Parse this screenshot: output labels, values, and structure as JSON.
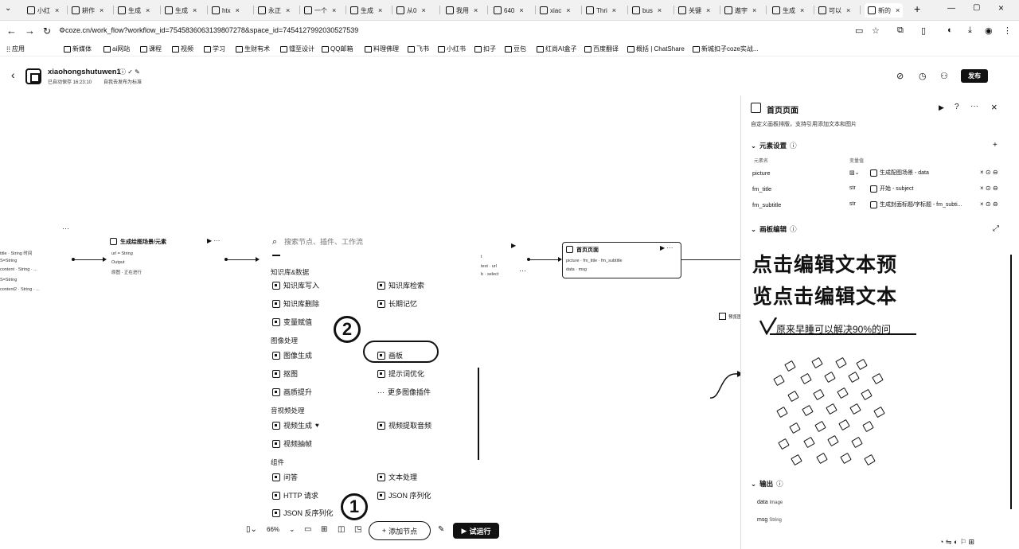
{
  "browser": {
    "tabs": [
      "小红",
      "耕作",
      "生成",
      "生成",
      "htx",
      "永正",
      "一个",
      "生成",
      "从0",
      "我用",
      "640",
      "xiac",
      "Thri",
      "bus",
      "关键",
      "遨宇",
      "生成",
      "可以",
      "新的"
    ],
    "new_tab": "+",
    "url": "coze.cn/work_flow?workflow_id=7545836063139807278&space_id=7454127992030527539",
    "bookmarks": [
      "应用",
      "新媒体",
      "ai网站",
      "课程",
      "视频",
      "学习",
      "生财有术",
      "镭至设计",
      "QQ邮箱",
      "料理佛理",
      "飞书",
      "小红书",
      "扣子",
      "豆包",
      "红尚AI盒子",
      "百度翻译",
      "概括 | ChatShare",
      "新城扣子coze实战..."
    ]
  },
  "header": {
    "title": "xiaohongshutuwen1",
    "saved": "已自动保存 16:23:10",
    "version": "自我去发布为标准",
    "publish": "发布"
  },
  "canvas": {
    "node1": {
      "title": "生成绘图场景/元素",
      "lines": [
        "url = String",
        "Output",
        "原图 · 正在进行"
      ]
    },
    "node_left": {
      "lines": [
        "title · String 时间",
        "S=String",
        "content · String · ...",
        "S=String",
        "content2 · String · ..."
      ]
    },
    "node_mid": {
      "lines": [
        "t",
        "text · url",
        "b · select"
      ]
    },
    "node_home": {
      "title": "首页页面",
      "lines": [
        "picture · fm_title · fm_subtitle",
        "data · msg"
      ]
    },
    "preview_label": "预览图"
  },
  "menu": {
    "search_placeholder": "搜索节点、插件、工作流",
    "sections": [
      "知识库&数据",
      "图像处理",
      "音视频处理",
      "组件"
    ],
    "items_col1": [
      "知识库写入",
      "知识库删除",
      "变量赋值",
      "图像生成",
      "抠图",
      "画质提升",
      "视频生成",
      "视频抽帧",
      "问答",
      "HTTP 请求",
      "JSON 反序列化"
    ],
    "items_col2": [
      "知识库检索",
      "长期记忆",
      "画板",
      "提示词优化",
      "更多图像插件",
      "视频提取音频",
      "文本处理",
      "JSON 序列化"
    ]
  },
  "annotations": {
    "one": "1",
    "two": "2"
  },
  "toolbar": {
    "zoom": "66%",
    "add_node": "添加节点",
    "run": "试运行"
  },
  "panel": {
    "title": "首页页面",
    "desc": "自定义画板排版，支持引用添加文本和图片",
    "elements_header": "元素设置",
    "col_name": "元素名",
    "col_value": "变量值",
    "rows": [
      {
        "name": "picture",
        "type": "img",
        "value": "生成配图场景 - data"
      },
      {
        "name": "fm_title",
        "type": "str",
        "value": "开始 - subject"
      },
      {
        "name": "fm_subtitle",
        "type": "str",
        "value": "生成封面标题/字标题 - fm_subti..."
      }
    ],
    "canvas_header": "画板编辑",
    "preview_line1": "点击编辑文本预",
    "preview_line2": "览点击编辑文本",
    "preview_tagline": "原来早睡可以解决90%的问",
    "output_header": "输出",
    "outputs": [
      {
        "name": "data",
        "type": "Image"
      },
      {
        "name": "msg",
        "type": "String"
      }
    ]
  }
}
